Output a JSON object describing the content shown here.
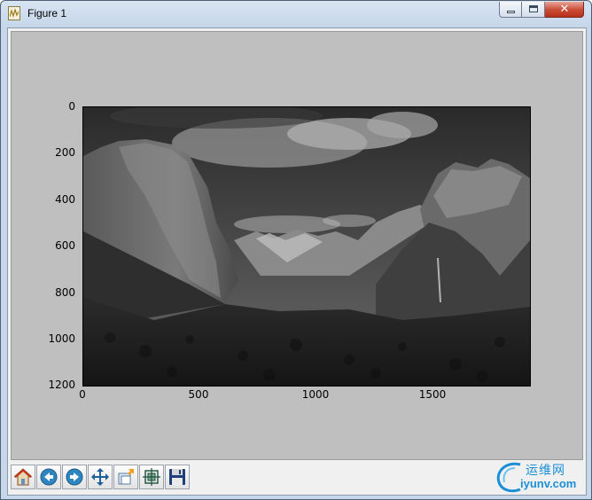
{
  "window": {
    "title": "Figure 1",
    "close_symbol": "✕"
  },
  "figure": {
    "image_description_icon": "landscape-photo",
    "y_ticks": [
      "0",
      "200",
      "400",
      "600",
      "800",
      "1000",
      "1200"
    ],
    "x_ticks": [
      "0",
      "500",
      "1000",
      "1500"
    ]
  },
  "chart_data": {
    "type": "image",
    "x_ticks": [
      0,
      500,
      1000,
      1500
    ],
    "y_ticks": [
      0,
      200,
      400,
      600,
      800,
      1000,
      1200
    ],
    "xlim": [
      0,
      1920
    ],
    "ylim": [
      1200,
      0
    ],
    "y_axis_inverted": true,
    "grid": false,
    "colormap": "gray"
  },
  "toolbar": {
    "buttons": [
      {
        "name": "home-button",
        "icon": "home-icon"
      },
      {
        "name": "back-button",
        "icon": "arrow-left-icon"
      },
      {
        "name": "forward-button",
        "icon": "arrow-right-icon"
      },
      {
        "name": "pan-button",
        "icon": "move-arrows-icon"
      },
      {
        "name": "zoom-button",
        "icon": "zoom-rect-icon"
      },
      {
        "name": "configure-subplots-button",
        "icon": "subplots-icon"
      },
      {
        "name": "save-button",
        "icon": "floppy-disk-icon"
      }
    ]
  },
  "watermark": {
    "text_cn": "运维网",
    "url": "iyunv.com",
    "accent": "#1b8fd6"
  }
}
